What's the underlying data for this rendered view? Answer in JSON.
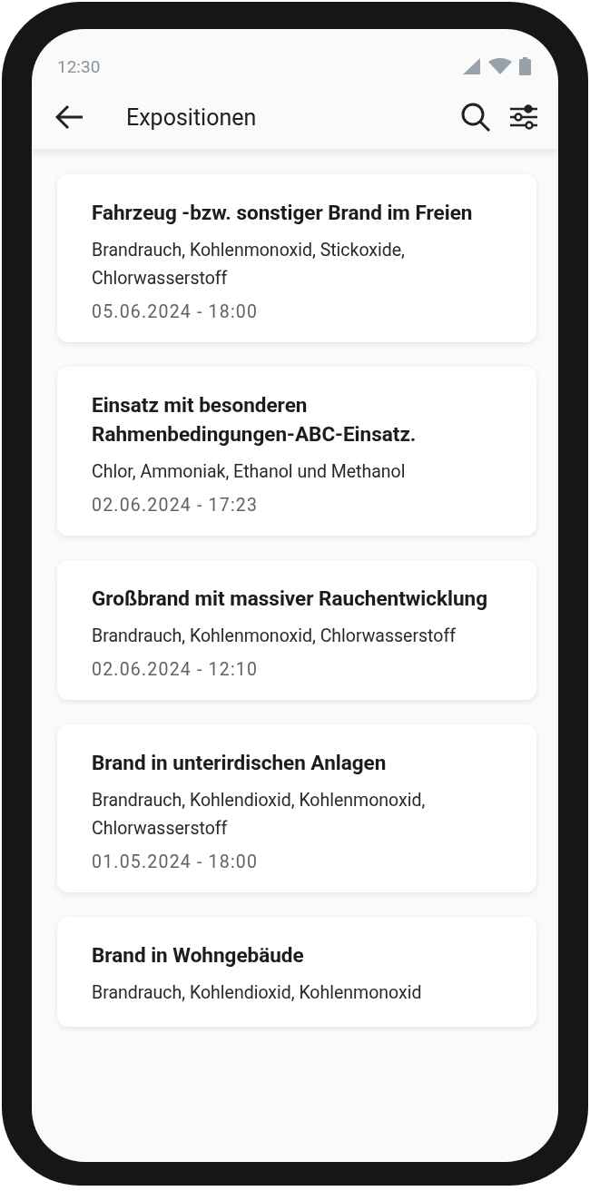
{
  "status_bar": {
    "time": "12:30"
  },
  "app_bar": {
    "title": "Expositionen"
  },
  "cards": [
    {
      "title": "Fahrzeug -bzw. sonstiger Brand im Freien",
      "substances": "Brandrauch, Kohlenmonoxid, Stickoxide, Chlorwasserstoff",
      "date": "05.06.2024 - 18:00"
    },
    {
      "title": "Einsatz mit besonderen Rahmenbedingungen-ABC-Einsatz.",
      "substances": "Chlor, Ammoniak, Ethanol und Methanol",
      "date": "02.06.2024 - 17:23"
    },
    {
      "title": "Großbrand mit massiver Rauchentwicklung",
      "substances": "Brandrauch, Kohlenmonoxid, Chlorwasserstoff",
      "date": "02.06.2024 - 12:10"
    },
    {
      "title": "Brand in unterirdischen Anlagen",
      "substances": "Brandrauch, Kohlendioxid, Kohlenmonoxid, Chlorwasserstoff",
      "date": "01.05.2024 - 18:00"
    },
    {
      "title": "Brand in Wohngebäude",
      "substances": "Brandrauch, Kohlendioxid, Kohlenmonoxid"
    }
  ]
}
